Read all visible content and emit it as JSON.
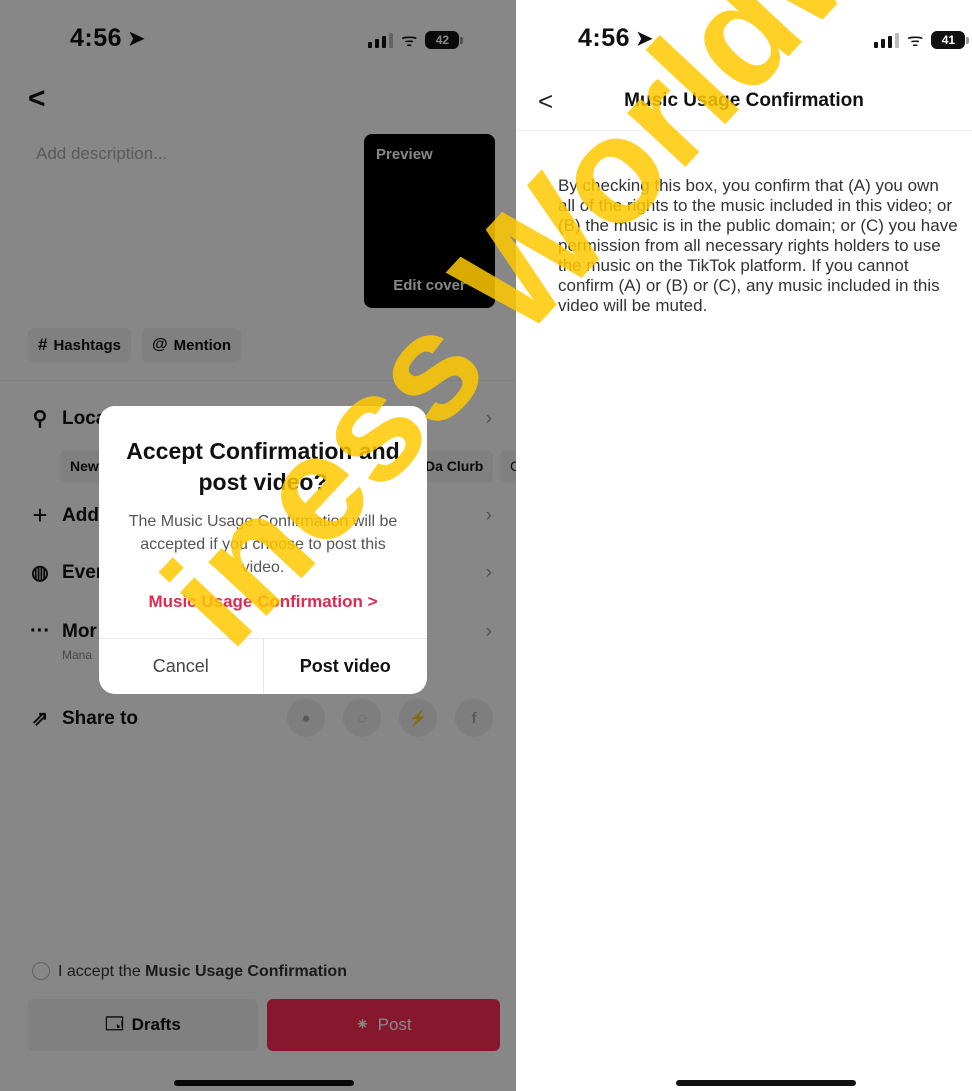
{
  "left_screen": {
    "status": {
      "time": "4:56",
      "battery": "42"
    },
    "back_glyph": "<",
    "description_placeholder": "Add description...",
    "preview": {
      "label": "Preview",
      "edit_cover": "Edit cover"
    },
    "chips": {
      "hashtags": "Hashtags",
      "mention": "Mention",
      "hashtag_symbol": "#",
      "mention_symbol": "@"
    },
    "rows": {
      "location": "Loca",
      "add": "Add",
      "events": "Ever",
      "more": "Mor",
      "more_sub": "Mana",
      "share_to": "Share to"
    },
    "location_chips": [
      "New",
      "Da Clurb",
      "C"
    ],
    "accept_checkbox": {
      "prefix": "I accept the ",
      "bold": "Music Usage Confirmation"
    },
    "bottom_buttons": {
      "drafts": "Drafts",
      "post": "Post"
    },
    "dialog": {
      "title": "Accept Confirmation and post video?",
      "message": "The Music Usage Confirmation will be accepted if you choose to post this video.",
      "link": "Music Usage Confirmation >",
      "cancel": "Cancel",
      "post_video": "Post video"
    }
  },
  "right_screen": {
    "status": {
      "time": "4:56",
      "battery": "41"
    },
    "header_title": "Music Usage Confirmation",
    "back_glyph": "<",
    "body": "By checking this box, you confirm that (A) you own all of the rights to the music included in this video; or (B) the music is in the public domain; or (C) you have permission from all necessary rights holders to use the music on the TikTok platform. If you cannot confirm (A) or (B) or (C), any music included in this video will be muted."
  },
  "watermark": "iness Worldwide",
  "colors": {
    "accent_red": "#e0294d",
    "post_button_red": "#fe2c55",
    "watermark": "#ffc800"
  }
}
